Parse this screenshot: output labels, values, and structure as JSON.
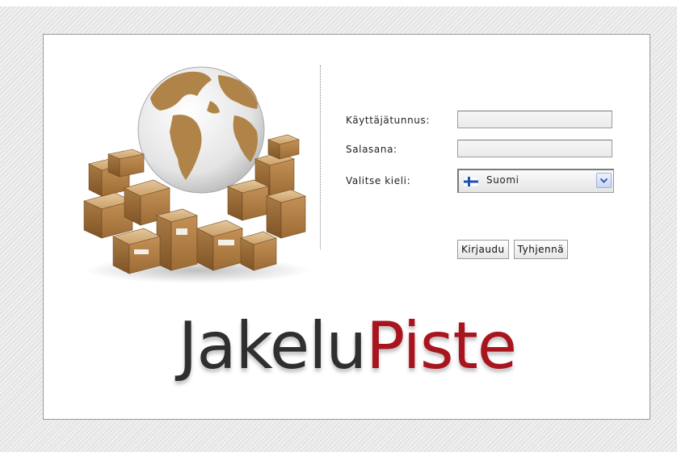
{
  "form": {
    "username_label": "Käyttäjätunnus:",
    "username_value": "",
    "password_label": "Salasana:",
    "password_value": "",
    "language_label": "Valitse kieli:",
    "language_selected": "Suomi",
    "login_button": "Kirjaudu",
    "clear_button": "Tyhjennä"
  },
  "brand": {
    "name_part_1": "Jakelu",
    "name_part_2": "Piste",
    "color_dark": "#2f2f2f",
    "color_red": "#a8151f"
  },
  "illustration": {
    "name": "globe-with-packages"
  },
  "icons": {
    "flag": "finland-flag-icon",
    "dropdown": "chevron-down-icon"
  }
}
